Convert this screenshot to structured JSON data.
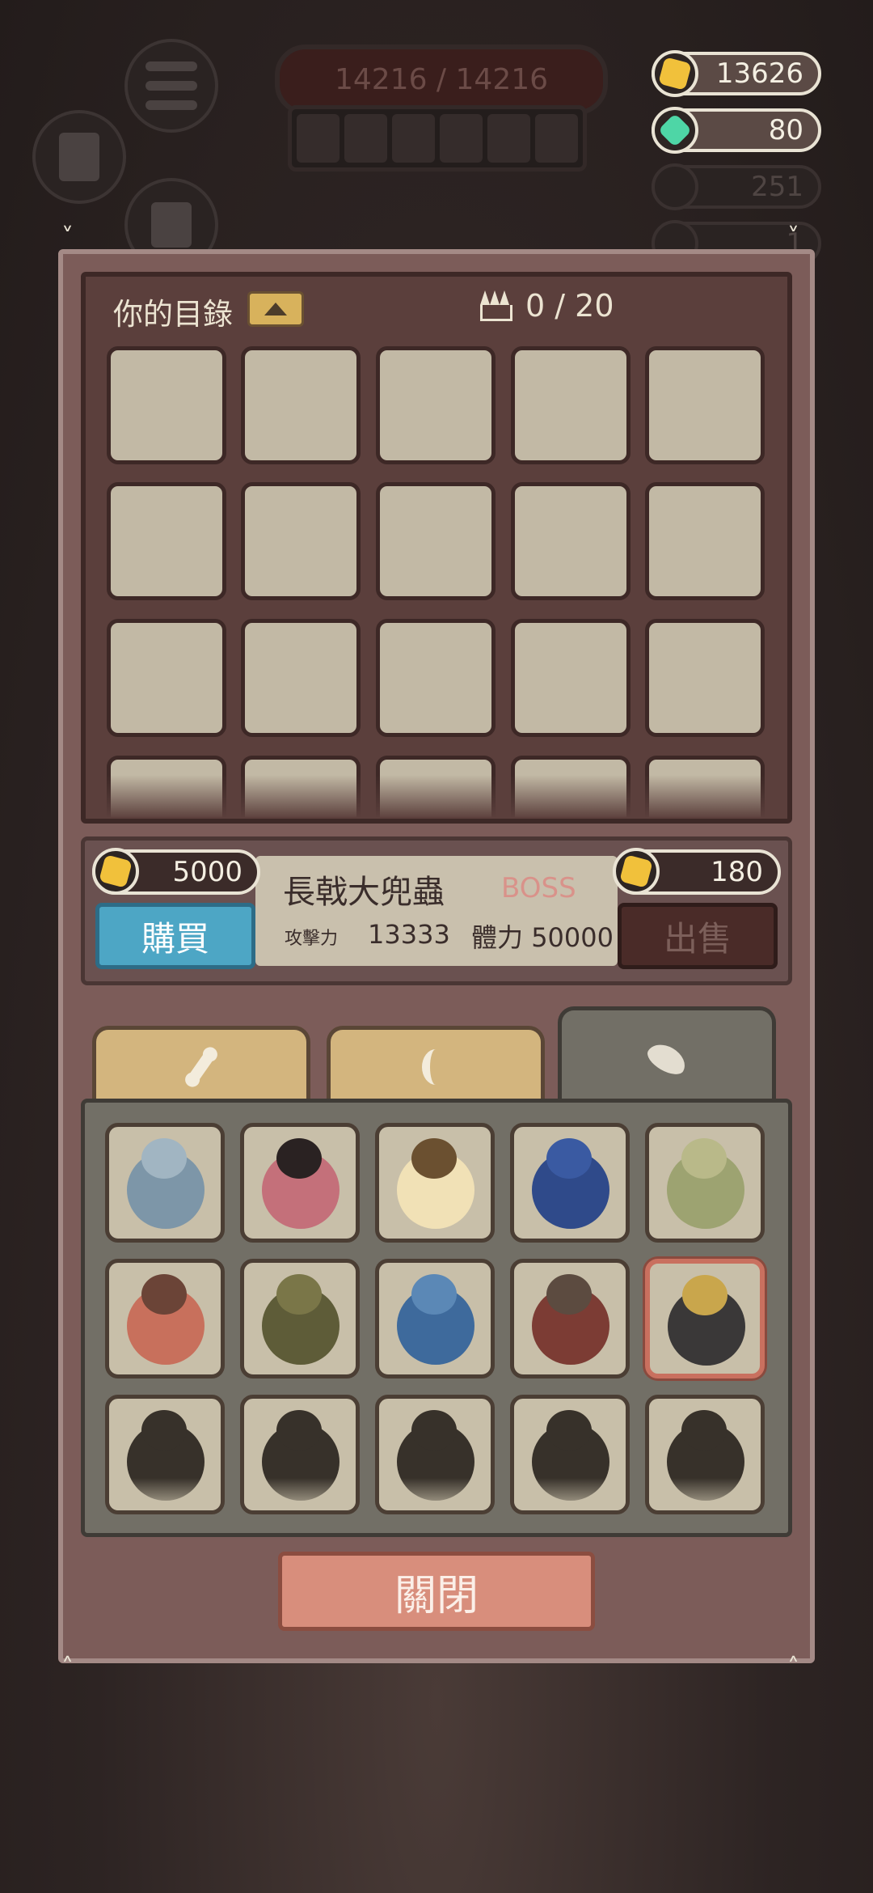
{
  "hud": {
    "hp_text": "14216 / 14216",
    "coins": "13626",
    "gems": "80",
    "bones": "251",
    "claws": "1"
  },
  "inventory": {
    "title": "你的目錄",
    "capacity": "0 / 20"
  },
  "item": {
    "name": "長戟大兜蟲",
    "tag": "BOSS",
    "attack_label": "攻擊力",
    "attack_value": "13333",
    "hp_label": "體力",
    "hp_value": "50000",
    "buy_price": "5000",
    "sell_price": "180",
    "buy_label": "購買",
    "sell_label": "出售"
  },
  "tabs": [
    {
      "icon": "bone-icon"
    },
    {
      "icon": "claw-icon"
    },
    {
      "icon": "wing-icon",
      "active": true
    }
  ],
  "close_label": "關閉",
  "colors": {
    "panel": "#7c5c59",
    "buy": "#4da6c5",
    "sell": "#4a2b28",
    "close": "#d88e7c",
    "selected_border": "#c9705f"
  }
}
